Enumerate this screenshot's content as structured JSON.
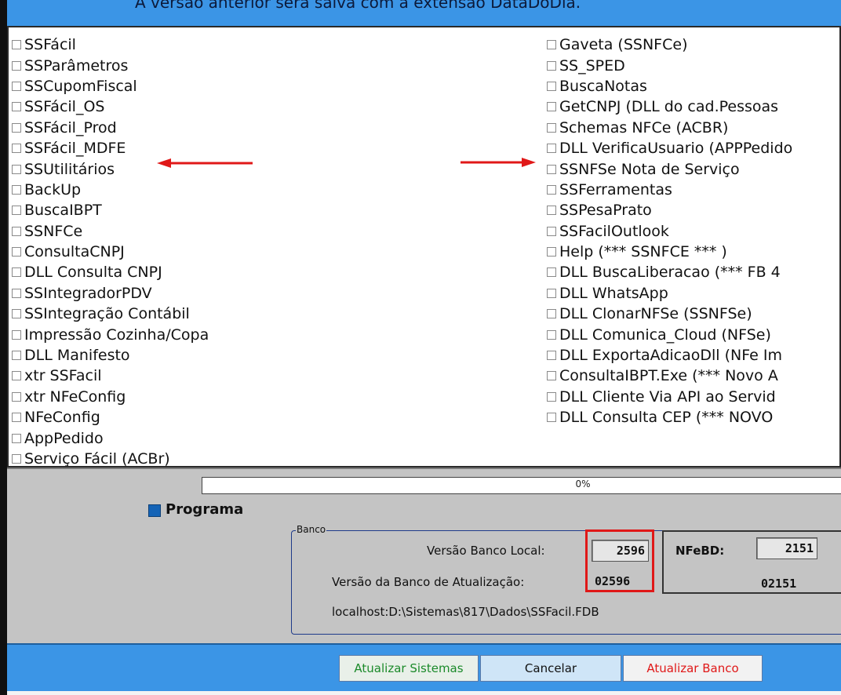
{
  "header": {
    "notice": "A versão anterior será salva com a extensão DataDoDia."
  },
  "modules_left": [
    "SSFácil",
    "SSParâmetros",
    "SSCupomFiscal",
    "SSFácil_OS",
    "SSFácil_Prod",
    "SSFácil_MDFE",
    "SSUtilitários",
    "BackUp",
    "BuscaIBPT",
    "SSNFCe",
    "ConsultaCNPJ",
    "DLL Consulta CNPJ",
    "SSIntegradorPDV",
    "SSIntegração Contábil",
    "Impressão Cozinha/Copa",
    "DLL Manifesto",
    "xtr SSFacil",
    "xtr NFeConfig",
    "NFeConfig",
    "AppPedido",
    "Serviço Fácil (ACBr)"
  ],
  "modules_right": [
    "Gaveta (SSNFCe)",
    "SS_SPED",
    "BuscaNotas",
    "GetCNPJ (DLL do cad.Pessoas",
    "Schemas NFCe (ACBR)",
    "DLL VerificaUsuario (APPPedido",
    "SSNFSe Nota de Serviço",
    "SSFerramentas",
    "SSPesaPrato",
    "SSFacilOutlook",
    "Help (*** SSNFCE *** )",
    "DLL BuscaLiberacao (*** FB 4",
    "DLL WhatsApp",
    "DLL ClonarNFSe (SSNFSe)",
    "DLL Comunica_Cloud (NFSe)",
    "DLL ExportaAdicaoDll (NFe Im",
    "ConsultaIBPT.Exe (*** Novo A",
    "DLL Cliente Via API ao Servid",
    "DLL Consulta CEP (*** NOVO"
  ],
  "progress": {
    "label": "0%",
    "value": 0
  },
  "programa": {
    "label": "Programa"
  },
  "banco": {
    "legend": "Banco",
    "local_label": "Versão Banco Local:",
    "local_value": "2596",
    "update_label": "Versão da Banco de Atualização:",
    "update_value": "02596",
    "nfebd_label": "NFeBD:",
    "nfebd_local": "2151",
    "nfebd_update": "02151",
    "path": "localhost:D:\\Sistemas\\817\\Dados\\SSFacil.FDB"
  },
  "buttons": {
    "update_systems": "Atualizar Sistemas",
    "cancel": "Cancelar",
    "update_db": "Atualizar Banco"
  },
  "colors": {
    "accent": "#3b95e6",
    "highlight": "#e01818"
  }
}
